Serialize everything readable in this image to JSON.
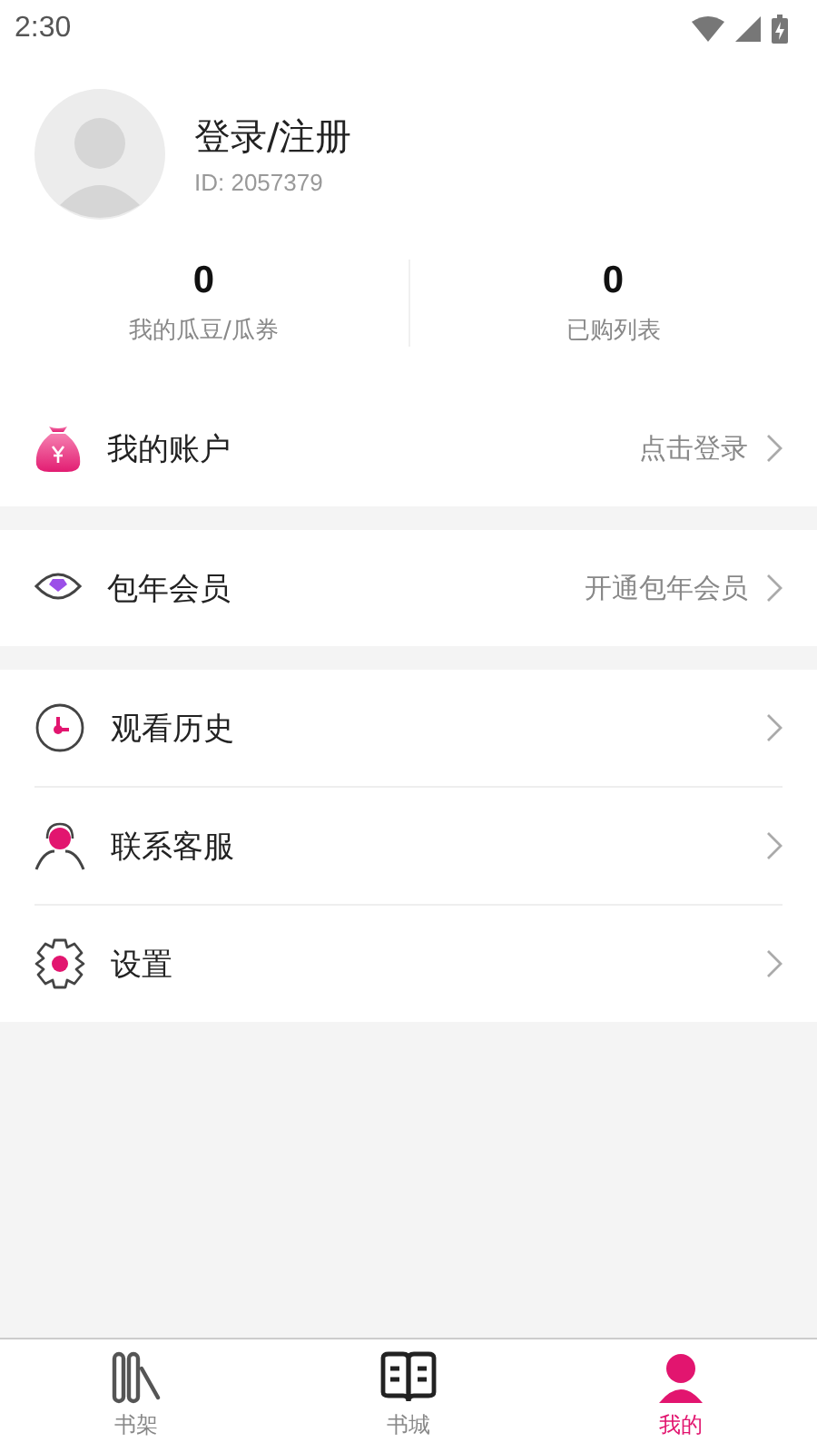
{
  "status_bar": {
    "time": "2:30"
  },
  "profile": {
    "name": "登录/注册",
    "id": "ID: 2057379"
  },
  "stats": [
    {
      "value": "0",
      "label": "我的瓜豆/瓜券"
    },
    {
      "value": "0",
      "label": "已购列表"
    }
  ],
  "menu_groups": [
    [
      {
        "kind": "wallet",
        "label": "我的账户",
        "hint": "点击登录"
      }
    ],
    [
      {
        "kind": "diamond",
        "label": "包年会员",
        "hint": "开通包年会员"
      }
    ],
    [
      {
        "kind": "history",
        "label": "观看历史"
      },
      {
        "kind": "service",
        "label": "联系客服"
      },
      {
        "kind": "settings",
        "label": "设置"
      }
    ]
  ],
  "tabs": [
    {
      "kind": "shelf",
      "label": "书架",
      "selected": false
    },
    {
      "kind": "store",
      "label": "书城",
      "selected": false
    },
    {
      "kind": "me",
      "label": "我的",
      "selected": true
    }
  ]
}
